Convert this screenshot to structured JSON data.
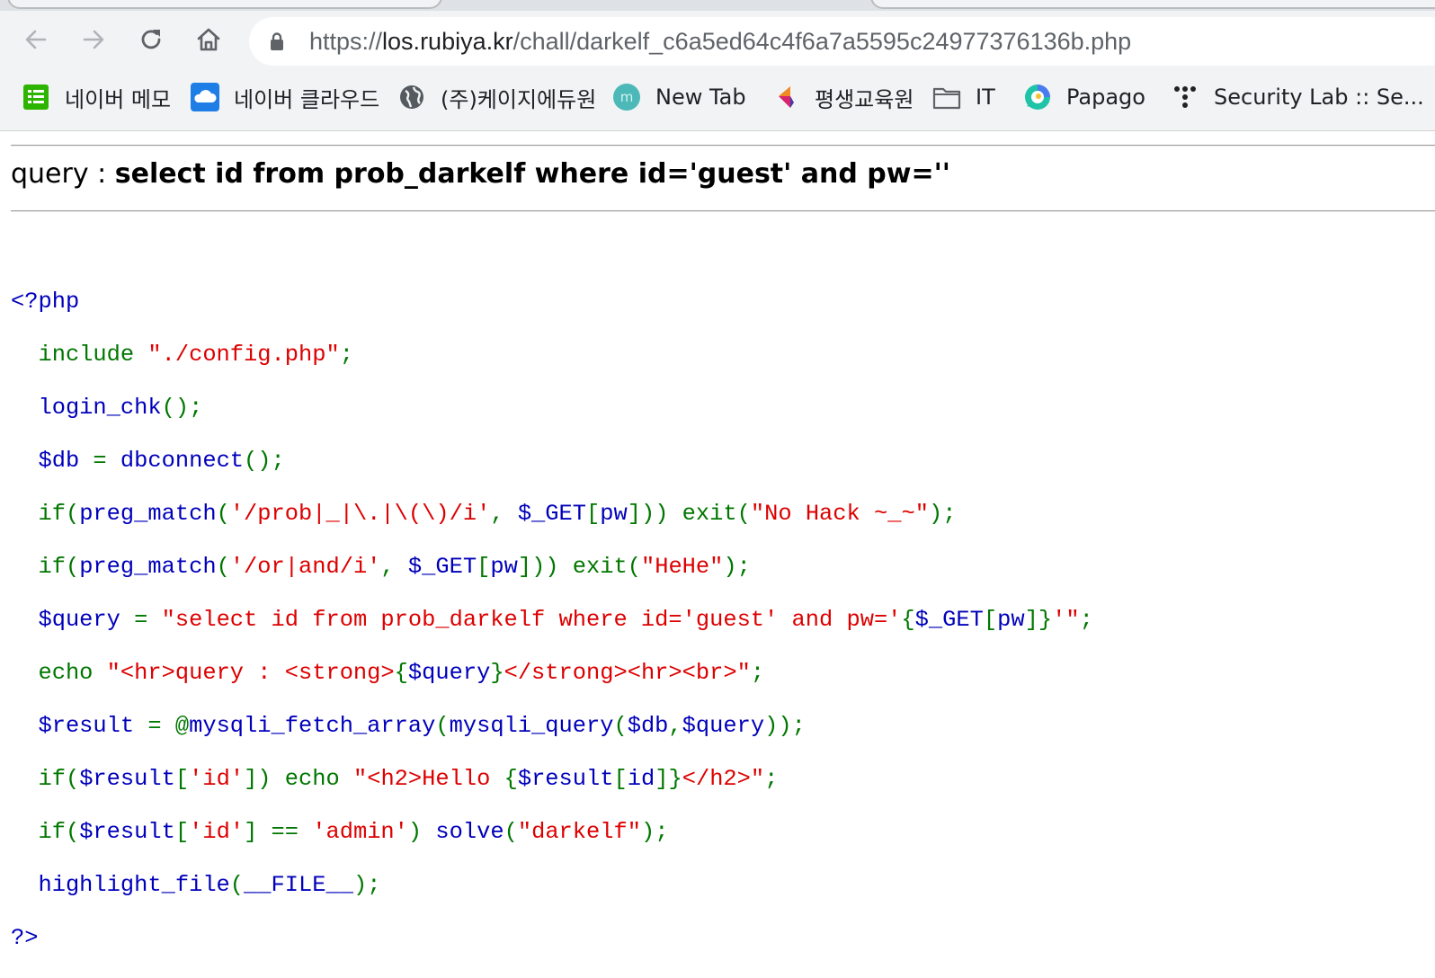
{
  "browser": {
    "url_scheme": "https://",
    "url_host": "los.rubiya.kr",
    "url_path": "/chall/darkelf_c6a5ed64c4f6a7a5595c24977376136b.php"
  },
  "bookmarks": [
    {
      "label": "네이버 메모",
      "icon": "naver-memo-icon"
    },
    {
      "label": "네이버 클라우드",
      "icon": "naver-cloud-icon"
    },
    {
      "label": "(주)케이지에듀원",
      "icon": "globe-icon"
    },
    {
      "label": "New Tab",
      "icon": "new-tab-icon"
    },
    {
      "label": "평생교육원",
      "icon": "lifelong-edu-icon"
    },
    {
      "label": "IT",
      "icon": "folder-icon"
    },
    {
      "label": "Papago",
      "icon": "papago-icon"
    },
    {
      "label": "Security Lab :: Se...",
      "icon": "security-lab-icon"
    }
  ],
  "page": {
    "query_label": "query : ",
    "query_text": "select id from prob_darkelf where id='guest' and pw=''"
  },
  "code": {
    "l01_a": "<?php",
    "l02_a": "  include ",
    "l02_b": "\"./config.php\"",
    "l02_c": ";",
    "l03_a": "  login_chk",
    "l03_b": "();",
    "l04_a": "  $db ",
    "l04_b": "= ",
    "l04_c": "dbconnect",
    "l04_d": "();",
    "l05_a": "  if(",
    "l05_b": "preg_match",
    "l05_c": "(",
    "l05_d": "'/prob|_|\\.|\\(\\)/i'",
    "l05_e": ", ",
    "l05_f": "$_GET",
    "l05_g": "[",
    "l05_h": "pw",
    "l05_i": "])) exit(",
    "l05_j": "\"No Hack ~_~\"",
    "l05_k": ");",
    "l06_a": "  if(",
    "l06_b": "preg_match",
    "l06_c": "(",
    "l06_d": "'/or|and/i'",
    "l06_e": ", ",
    "l06_f": "$_GET",
    "l06_g": "[",
    "l06_h": "pw",
    "l06_i": "])) exit(",
    "l06_j": "\"HeHe\"",
    "l06_k": ");",
    "l07_a": "  $query ",
    "l07_b": "= ",
    "l07_c": "\"select id from prob_darkelf where id='guest' and pw='",
    "l07_d": "{",
    "l07_e": "$_GET",
    "l07_f": "[",
    "l07_g": "pw",
    "l07_h": "]}",
    "l07_i": "'\"",
    "l07_j": ";",
    "l08_a": "  echo ",
    "l08_b": "\"<hr>query : <strong>",
    "l08_c": "{",
    "l08_d": "$query",
    "l08_e": "}",
    "l08_f": "</strong><hr><br>\"",
    "l08_g": ";",
    "l09_a": "  $result ",
    "l09_b": "= @",
    "l09_c": "mysqli_fetch_array",
    "l09_d": "(",
    "l09_e": "mysqli_query",
    "l09_f": "(",
    "l09_g": "$db",
    "l09_h": ",",
    "l09_i": "$query",
    "l09_j": "));",
    "l10_a": "  if(",
    "l10_b": "$result",
    "l10_c": "[",
    "l10_d": "'id'",
    "l10_e": "]) echo ",
    "l10_f": "\"<h2>Hello ",
    "l10_g": "{",
    "l10_h": "$result",
    "l10_i": "[",
    "l10_j": "id",
    "l10_k": "]}",
    "l10_l": "</h2>\"",
    "l10_m": ";",
    "l11_a": "  if(",
    "l11_b": "$result",
    "l11_c": "[",
    "l11_d": "'id'",
    "l11_e": "] == ",
    "l11_f": "'admin'",
    "l11_g": ") ",
    "l11_h": "solve",
    "l11_i": "(",
    "l11_j": "\"darkelf\"",
    "l11_k": ");",
    "l12_a": "  highlight_file",
    "l12_b": "(",
    "l12_c": "__FILE__",
    "l12_d": ");",
    "l13_a": "?>"
  },
  "colors": {
    "php_default": "#0000bb",
    "php_keyword": "#007700",
    "php_string": "#dd0000",
    "chrome_bg": "#f1f3f4"
  }
}
